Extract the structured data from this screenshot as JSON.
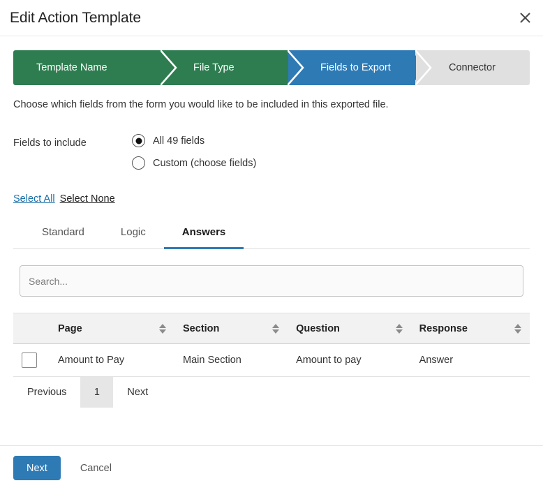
{
  "header": {
    "title": "Edit Action Template",
    "close_icon": "close-icon"
  },
  "wizard": {
    "steps": [
      {
        "label": "Template Name",
        "state": "completed",
        "color": "#2e7d50"
      },
      {
        "label": "File Type",
        "state": "completed",
        "color": "#2e7d50"
      },
      {
        "label": "Fields to Export",
        "state": "active",
        "color": "#2e7ab5"
      },
      {
        "label": "Connector",
        "state": "upcoming",
        "color": "#e0e0e0"
      }
    ]
  },
  "main": {
    "intro": "Choose which fields from the form you would like to be included in this exported file.",
    "fields_to_include_label": "Fields to include",
    "radios": [
      {
        "label": "All 49 fields",
        "selected": true
      },
      {
        "label": "Custom (choose fields)",
        "selected": false
      }
    ],
    "select_all_label": "Select All",
    "select_none_label": "Select None",
    "tabs": [
      {
        "label": "Standard",
        "active": false
      },
      {
        "label": "Logic",
        "active": false
      },
      {
        "label": "Answers",
        "active": true
      }
    ],
    "search": {
      "placeholder": "Search...",
      "value": ""
    },
    "table": {
      "columns": [
        "Page",
        "Section",
        "Question",
        "Response"
      ],
      "sort_icon": "sort-arrows-icon",
      "rows": [
        {
          "checked": false,
          "page": "Amount to Pay",
          "section": "Main Section",
          "question": "Amount to pay",
          "response": "Answer"
        }
      ]
    },
    "pagination": {
      "previous_label": "Previous",
      "current_page": "1",
      "next_label": "Next"
    }
  },
  "footer": {
    "next_label": "Next",
    "cancel_label": "Cancel",
    "accent_color": "#2e7ab5"
  }
}
